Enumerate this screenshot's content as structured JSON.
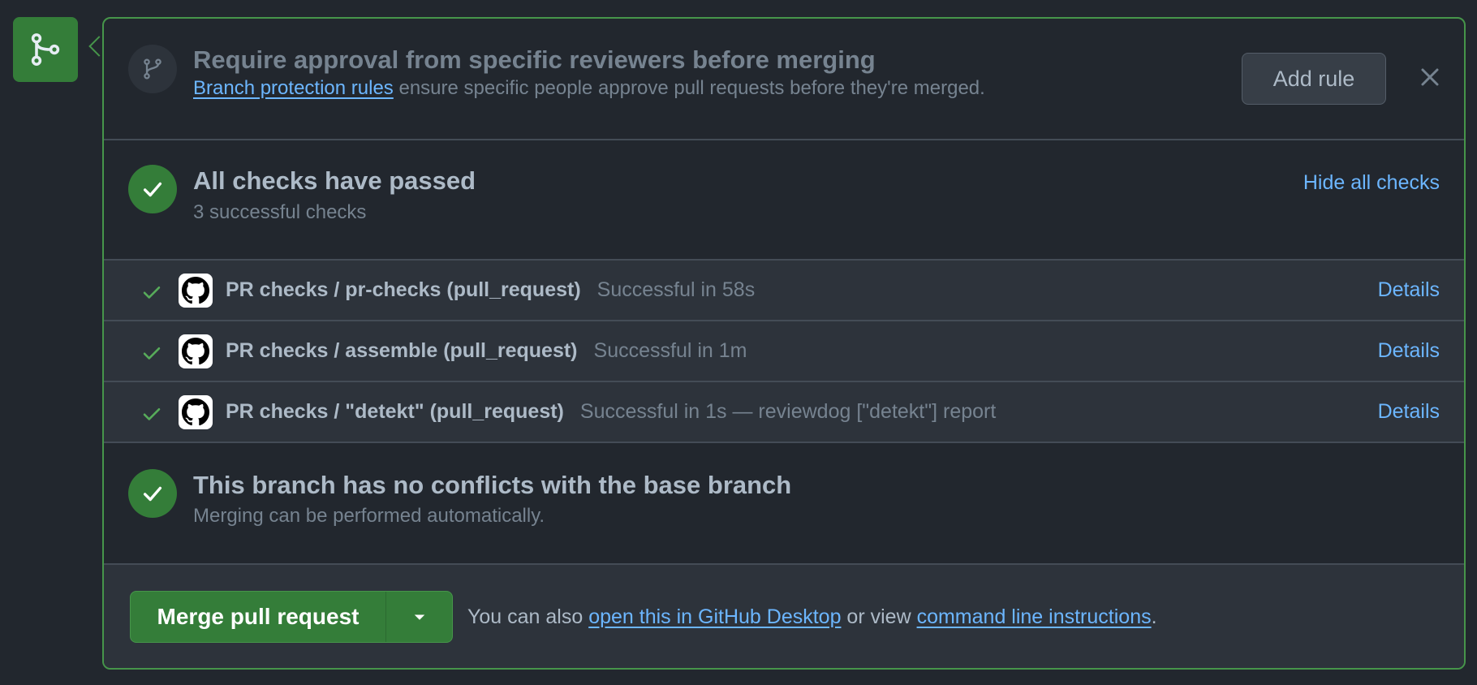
{
  "rule": {
    "title": "Require approval from specific reviewers before merging",
    "link": "Branch protection rules",
    "text": " ensure specific people approve pull requests before they're merged.",
    "add_button": "Add rule"
  },
  "checks": {
    "title": "All checks have passed",
    "subtitle": "3 successful checks",
    "hide_link": "Hide all checks",
    "items": [
      {
        "name": "PR checks / pr-checks (pull_request)",
        "status": "Successful in 58s",
        "details": "Details"
      },
      {
        "name": "PR checks / assemble (pull_request)",
        "status": "Successful in 1m",
        "details": "Details"
      },
      {
        "name": "PR checks / \"detekt\" (pull_request)",
        "status": "Successful in 1s — reviewdog [\"detekt\"] report",
        "details": "Details"
      }
    ]
  },
  "conflicts": {
    "title": "This branch has no conflicts with the base branch",
    "subtitle": "Merging can be performed automatically."
  },
  "merge": {
    "button": "Merge pull request",
    "info_prefix": "You can also ",
    "desktop_link": "open this in GitHub Desktop",
    "info_middle": " or view ",
    "cli_link": "command line instructions",
    "info_suffix": "."
  },
  "icons": {
    "merge": "git-merge-icon",
    "branch": "git-branch-icon",
    "check": "check-icon",
    "github": "github-mark-icon",
    "close": "close-icon",
    "dropdown": "triangle-down-icon"
  },
  "colors": {
    "accent_green": "#347d39",
    "link_blue": "#6cb6ff",
    "background": "#22272e"
  }
}
